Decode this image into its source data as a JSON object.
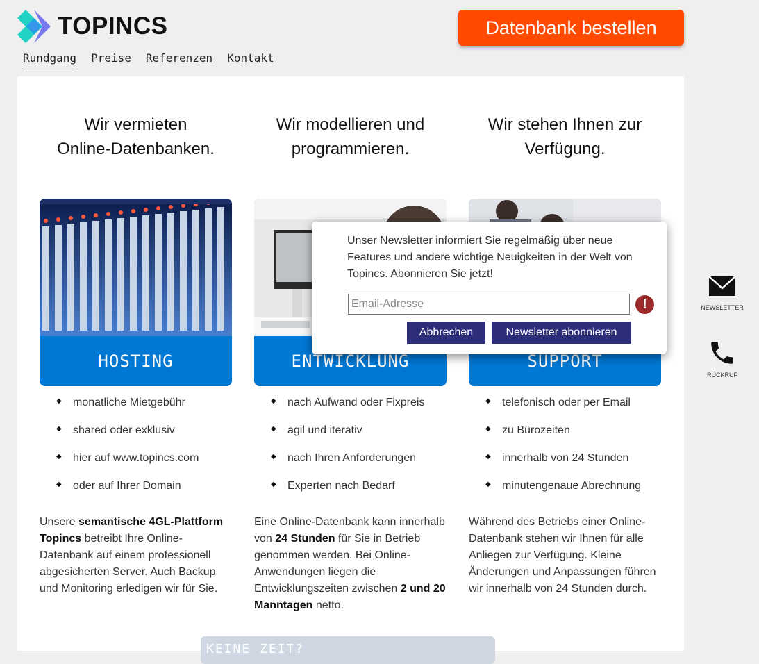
{
  "header": {
    "logo_text": "TOPINCS",
    "cta_label": "Datenbank bestellen",
    "nav": [
      "Rundgang",
      "Preise",
      "Referenzen",
      "Kontakt"
    ]
  },
  "columns": [
    {
      "title_line1": "Wir vermieten",
      "title_line2": "Online-Datenbanken.",
      "tile_label": "HOSTING",
      "bullets": [
        "monatliche Mietgebühr",
        "shared oder exklusiv",
        "hier auf www.topincs.com",
        "oder auf Ihrer Domain"
      ],
      "desc_before": "Unsere ",
      "desc_bold": "semantische 4GL-Plattform Topincs",
      "desc_after": " betreibt Ihre Online-Datenbank auf einem professionell abgesicherten Server. Auch Backup und Monitoring erledigen wir für Sie."
    },
    {
      "title_line1": "Wir modellieren und",
      "title_line2": "programmieren.",
      "tile_label": "ENTWICKLUNG",
      "bullets": [
        "nach Aufwand oder Fixpreis",
        "agil und iterativ",
        "nach Ihren Anforderungen",
        "Experten nach Bedarf"
      ],
      "desc_before": "Eine Online-Datenbank kann innerhalb von ",
      "desc_bold": "24 Stunden",
      "desc_middle": " für Sie in Betrieb genommen werden. Bei Online-Anwendungen liegen die Entwicklungszeiten zwischen ",
      "desc_bold2": "2 und 20 Manntagen",
      "desc_after": " netto."
    },
    {
      "title_line1": "Wir stehen Ihnen zur",
      "title_line2": "Verfügung.",
      "tile_label": "SUPPORT",
      "bullets": [
        "telefonisch oder per Email",
        "zu Bürozeiten",
        "innerhalb von 24 Stunden",
        "minutengenaue Abrechnung"
      ],
      "desc_before": "Während des Betriebs einer Online-Datenbank stehen wir Ihnen für alle Anliegen zur Verfügung. Kleine Änderungen und Anpassungen führen wir innerhalb von 24 Stunden durch."
    }
  ],
  "bottom_tag": "KEINE ZEIT?",
  "modal": {
    "text": "Unser Newsletter informiert Sie regelmäßig über neue Features und andere wichtige Neuigkeiten in der Welt von Topincs. Abonnieren Sie jetzt!",
    "email_placeholder": "Email-Adresse",
    "cancel_label": "Abbrechen",
    "subscribe_label": "Newsletter abonnieren",
    "warning_glyph": "!"
  },
  "side": {
    "newsletter_label": "NEWSLETTER",
    "callback_label": "RÜCKRUF"
  },
  "colors": {
    "cta": "#ff4a00",
    "tile_band": "#0078d4",
    "modal_button": "#2d2e7a",
    "warning": "#9c2a2a"
  }
}
